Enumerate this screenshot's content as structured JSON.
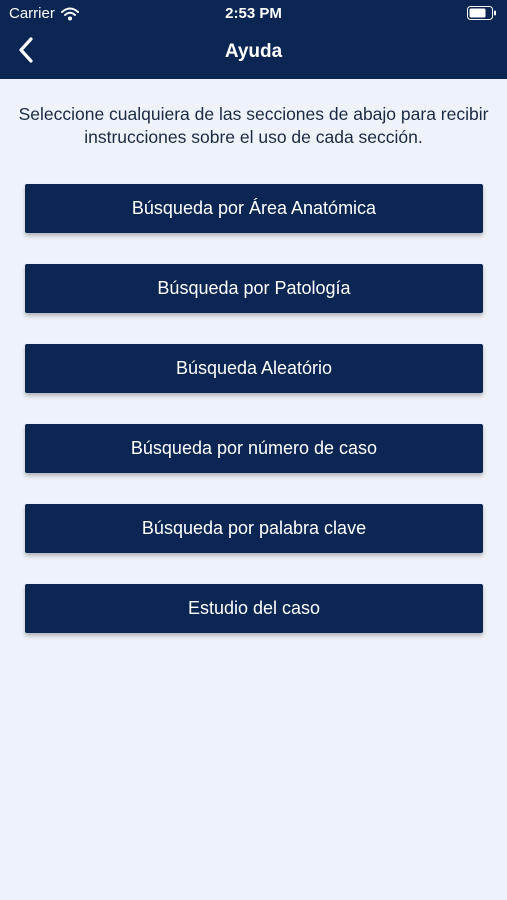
{
  "status_bar": {
    "carrier": "Carrier",
    "time": "2:53 PM",
    "wifi_icon": "wifi-icon",
    "battery_icon": "battery-icon"
  },
  "nav": {
    "title": "Ayuda",
    "back_icon": "chevron-left-icon"
  },
  "intro": {
    "text": "Seleccione cualquiera de las secciones de abajo para recibir instrucciones sobre el uso de cada sección."
  },
  "sections": [
    {
      "label": "Búsqueda por Área Anatómica"
    },
    {
      "label": "Búsqueda por Patología"
    },
    {
      "label": "Búsqueda Aleatório"
    },
    {
      "label": "Búsqueda por número de caso"
    },
    {
      "label": "Búsqueda por palabra clave"
    },
    {
      "label": "Estudio del caso"
    }
  ],
  "colors": {
    "brand_navy": "#0c2654",
    "background": "#eef3f9",
    "text_dark": "#1b2a44"
  }
}
